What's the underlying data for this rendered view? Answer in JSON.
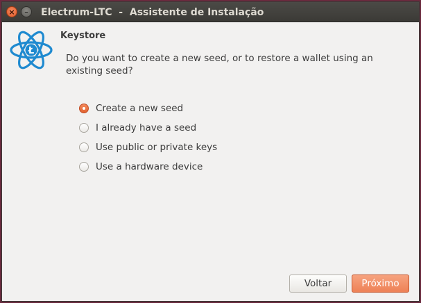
{
  "window": {
    "title": "Electrum-LTC  -  Assistente de Instalação",
    "close_glyph": "×",
    "minimize_glyph": "–"
  },
  "logo": {
    "icon": "electrum-ltc-atom-logo",
    "glyph": "Ł",
    "color": "#1f8ad0"
  },
  "page": {
    "heading": "Keystore",
    "question": "Do you want to create a new seed, or to restore a wallet using an existing seed?"
  },
  "options": [
    {
      "label": "Create a new seed",
      "selected": true
    },
    {
      "label": "I already have a seed",
      "selected": false
    },
    {
      "label": "Use public or private keys",
      "selected": false
    },
    {
      "label": "Use a hardware device",
      "selected": false
    }
  ],
  "buttons": {
    "back": "Voltar",
    "next": "Próximo"
  },
  "colors": {
    "accent": "#ee8156",
    "titlebar": "#3c3b37",
    "background": "#f2f1f0"
  }
}
